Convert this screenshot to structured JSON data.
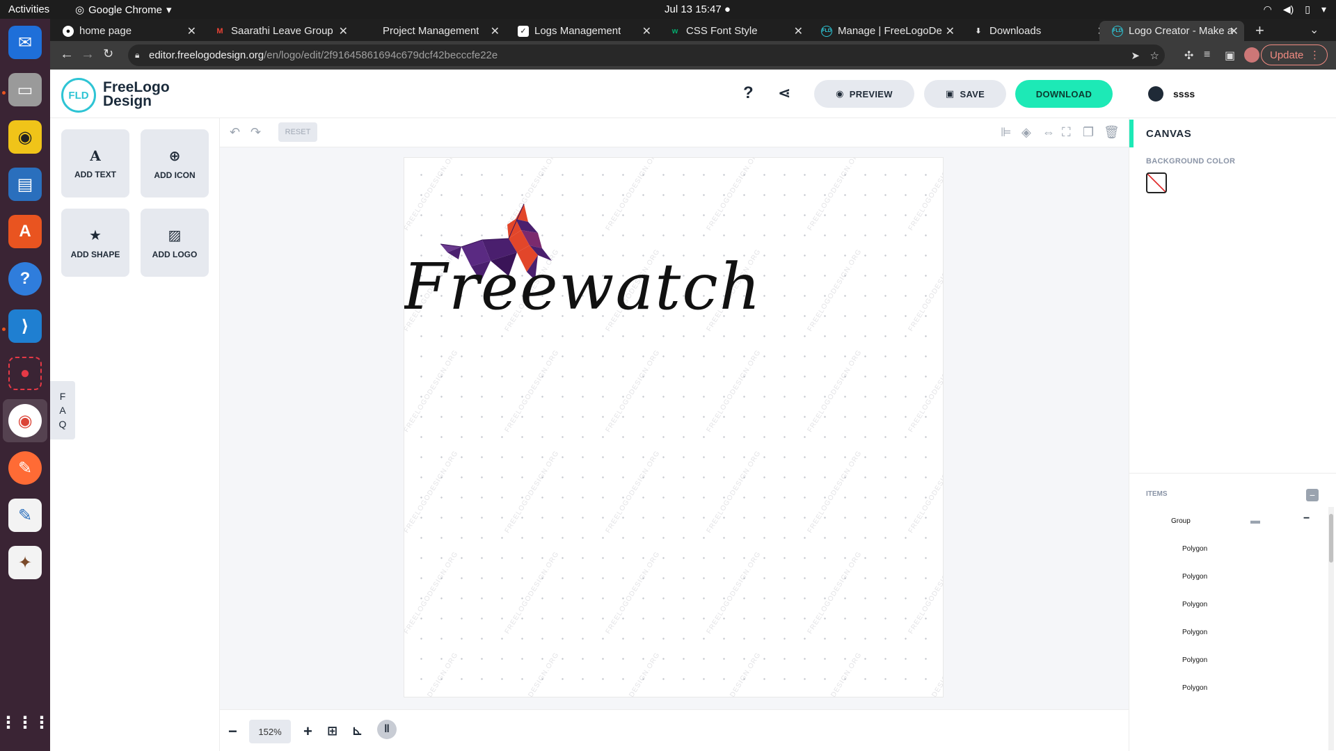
{
  "system": {
    "activities": "Activities",
    "app_name": "Google Chrome",
    "clock": "Jul 13  15:47"
  },
  "tabs": [
    {
      "label": "home page",
      "icon": "github-icon"
    },
    {
      "label": "Saarathi Leave Group",
      "icon": "gmail-icon"
    },
    {
      "label": "Project Management",
      "icon": "tab-icon"
    },
    {
      "label": "Logs Management",
      "icon": "checkbox-icon"
    },
    {
      "label": "CSS Font Style",
      "icon": "w3schools-icon"
    },
    {
      "label": "Manage | FreeLogoDe",
      "icon": "fld-icon"
    },
    {
      "label": "Downloads",
      "icon": "download-icon"
    },
    {
      "label": "Logo Creator - Make a",
      "icon": "fld-icon"
    }
  ],
  "address_bar": {
    "host": "editor.freelogodesign.org",
    "path": "/en/logo/edit/2f91645861694c679dcf42becccfe22e",
    "update_label": "Update"
  },
  "header": {
    "logo_mark": "FLD",
    "logo_line1": "FreeLogo",
    "logo_line2": "Design",
    "help_glyph": "?",
    "preview_label": "PREVIEW",
    "save_label": "SAVE",
    "download_label": "DOWNLOAD",
    "username": "ssss"
  },
  "left_panel": {
    "add_text": "ADD TEXT",
    "add_icon": "ADD ICON",
    "add_shape": "ADD SHAPE",
    "add_logo": "ADD LOGO",
    "faq": [
      "F",
      "A",
      "Q"
    ]
  },
  "canvas": {
    "reset_label": "RESET",
    "brand_text": "Freewatch",
    "watermark": "FREELOGODESIGN.ORG",
    "zoom": "152%"
  },
  "right_panel": {
    "title": "CANVAS",
    "background_label": "BACKGROUND COLOR",
    "items_label": "ITEMS",
    "items": [
      {
        "label": "Group"
      },
      {
        "label": "Polygon"
      },
      {
        "label": "Polygon"
      },
      {
        "label": "Polygon"
      },
      {
        "label": "Polygon"
      },
      {
        "label": "Polygon"
      },
      {
        "label": "Polygon"
      }
    ]
  },
  "colors": {
    "accent": "#1de9b6",
    "brand_teal": "#2ec4d4",
    "unicorn_purple": "#4a1f6e",
    "unicorn_red": "#e2462a"
  }
}
